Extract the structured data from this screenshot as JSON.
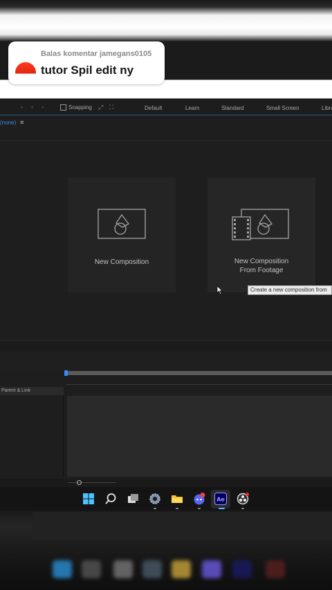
{
  "comment": {
    "reply_label": "Balas komentar jamegans0105",
    "text": "tutor Spil edit ny"
  },
  "toolbar": {
    "snapping_label": "Snapping",
    "workspaces": [
      "Default",
      "Learn",
      "Standard",
      "Small Screen",
      "Libra"
    ]
  },
  "panel": {
    "tab_label": "(none)",
    "menu_icon": "hamburger-menu-icon"
  },
  "cards": {
    "new_comp": "New Composition",
    "from_footage_line1": "New Composition",
    "from_footage_line2": "From Footage"
  },
  "tooltip": "Create a new composition from",
  "timeline": {
    "column_header": "Parent & Link"
  },
  "taskbar": {
    "icons": [
      "windows-start-icon",
      "search-icon",
      "task-view-icon",
      "settings-icon",
      "file-explorer-icon",
      "discord-icon",
      "after-effects-icon",
      "obs-icon"
    ],
    "ae_label": "Ae",
    "discord_badge": "9+"
  },
  "colors": {
    "accent_blue": "#2f8fff",
    "comment_avatar": "#e02612",
    "ae_purple": "#9999ff"
  }
}
